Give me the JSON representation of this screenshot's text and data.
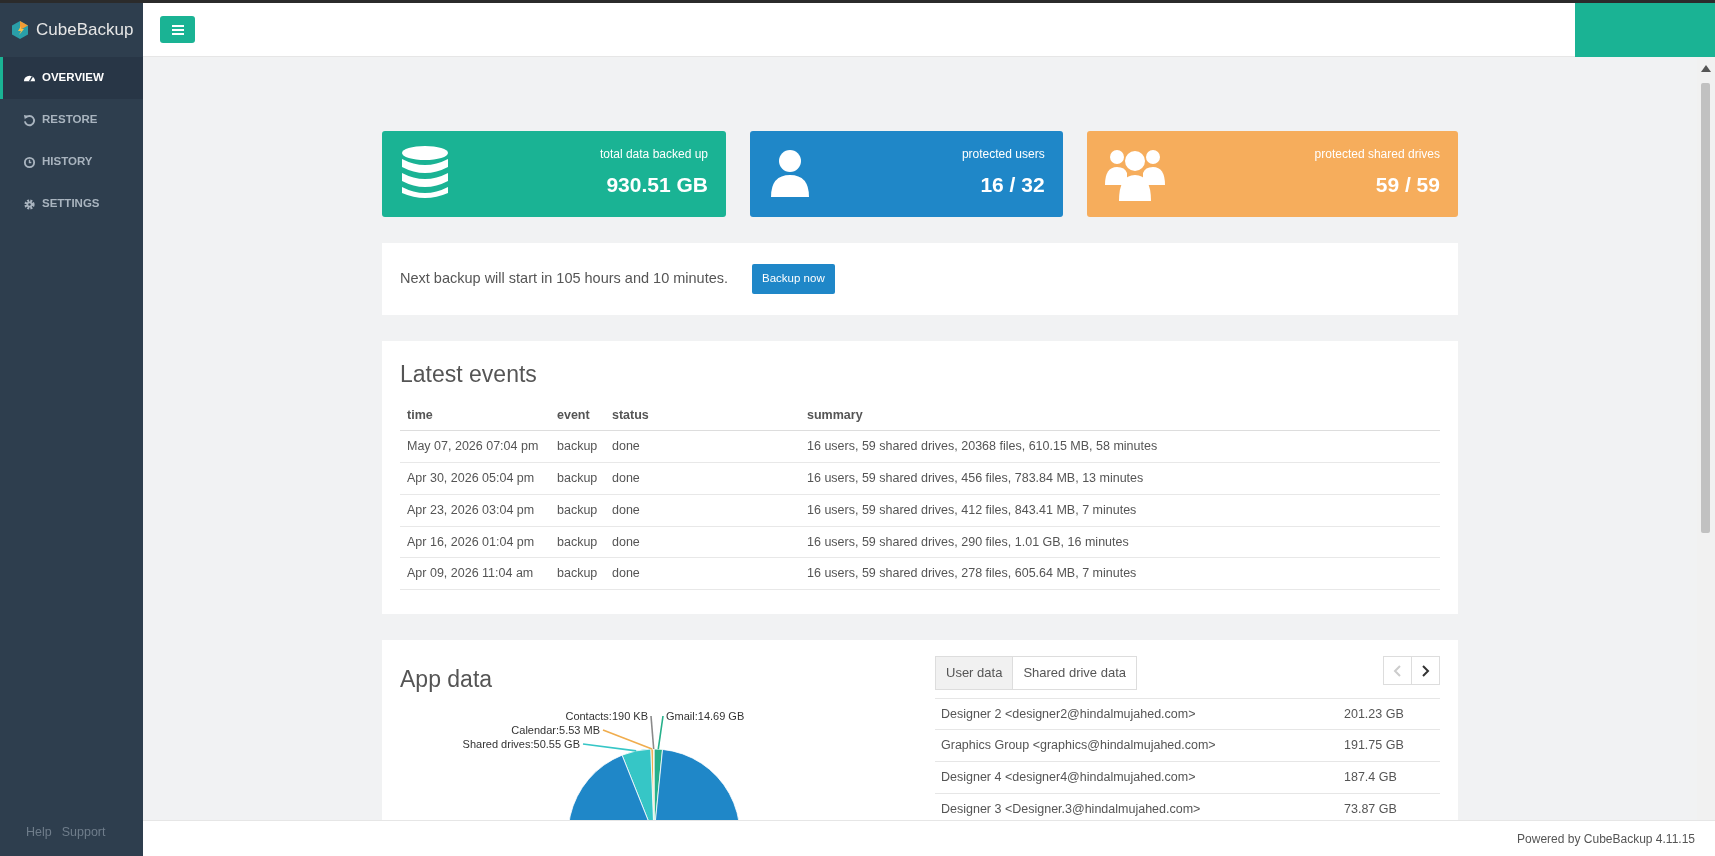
{
  "app": {
    "name": "CubeBackup"
  },
  "sidebar": {
    "items": [
      {
        "label": "OVERVIEW",
        "kind": "gauge",
        "selected": true
      },
      {
        "label": "RESTORE",
        "kind": "restore",
        "selected": false
      },
      {
        "label": "HISTORY",
        "kind": "clock",
        "selected": false
      },
      {
        "label": "SETTINGS",
        "kind": "gear",
        "selected": false
      }
    ],
    "footer_links": [
      "Help",
      "Support"
    ]
  },
  "stats": [
    {
      "label": "total data backed up",
      "value": "930.51 GB",
      "kind": "database",
      "color": "#1ab394"
    },
    {
      "label": "protected users",
      "value": "16 / 32",
      "kind": "user",
      "color": "#1f87c8"
    },
    {
      "label": "protected shared drives",
      "value": "59 / 59",
      "kind": "users",
      "color": "#f6ad5c"
    }
  ],
  "next_backup": {
    "text": "Next backup will start in 105 hours and 10 minutes.",
    "button": "Backup now"
  },
  "latest_events": {
    "title": "Latest events",
    "columns": [
      "time",
      "event",
      "status",
      "summary"
    ],
    "rows": [
      [
        "May 07, 2026 07:04 pm",
        "backup",
        "done",
        "16 users, 59 shared drives, 20368 files, 610.15 MB, 58 minutes"
      ],
      [
        "Apr 30, 2026 05:04 pm",
        "backup",
        "done",
        "16 users, 59 shared drives, 456 files, 783.84 MB, 13 minutes"
      ],
      [
        "Apr 23, 2026 03:04 pm",
        "backup",
        "done",
        "16 users, 59 shared drives, 412 files, 843.41 MB, 7 minutes"
      ],
      [
        "Apr 16, 2026 01:04 pm",
        "backup",
        "done",
        "16 users, 59 shared drives, 290 files, 1.01 GB, 16 minutes"
      ],
      [
        "Apr 09, 2026 11:04 am",
        "backup",
        "done",
        "16 users, 59 shared drives, 278 files, 605.64 MB, 7 minutes"
      ]
    ]
  },
  "app_data": {
    "title": "App data",
    "pie_labels": [
      {
        "text": "Gmail:14.69 GB",
        "color": "#26b08a"
      },
      {
        "text": "Contacts:190 KB",
        "color": "#8a8a8a"
      },
      {
        "text": "Calendar:5.53 MB",
        "color": "#f0ad4e"
      },
      {
        "text": "Shared drives:50.55 GB",
        "color": "#36c6c6"
      }
    ],
    "tabs": [
      {
        "label": "User data",
        "selected": true
      },
      {
        "label": "Shared drive data",
        "selected": false
      }
    ],
    "pager": [
      {
        "kind": "prev",
        "disabled": true
      },
      {
        "kind": "next",
        "disabled": false
      }
    ],
    "rows": [
      {
        "name": "Designer 2 <designer2@hindalmujahed.com>",
        "size": "201.23 GB"
      },
      {
        "name": "Graphics Group <graphics@hindalmujahed.com>",
        "size": "191.75 GB"
      },
      {
        "name": "Designer 4 <designer4@hindalmujahed.com>",
        "size": "187.4 GB"
      },
      {
        "name": "Designer 3 <Designer.3@hindalmujahed.com>",
        "size": "73.87 GB"
      }
    ]
  },
  "footer": {
    "text": "Powered by CubeBackup 4.11.15"
  }
}
